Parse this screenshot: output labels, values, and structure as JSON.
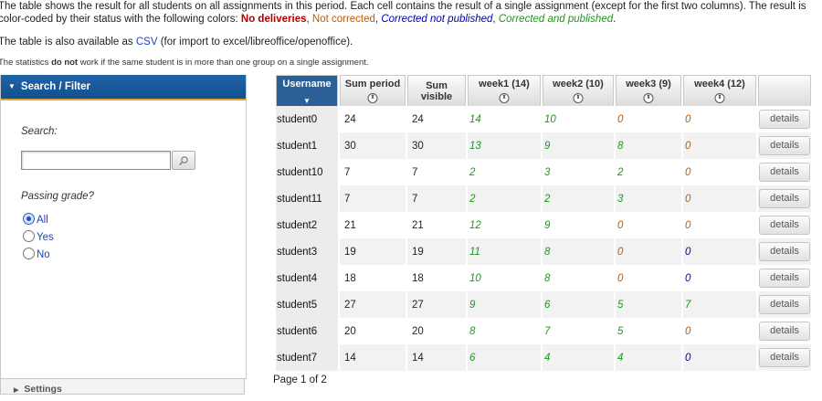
{
  "intro": {
    "p1_start": "The table shows the result for all students on all assignments in this period. Each cell contains the result of a single assignment (except for the first two columns). The result is color-coded by their status with the following colors: ",
    "legend_no_deliveries": "No deliveries",
    "sep1": ", ",
    "legend_not_corrected": "Not corrected",
    "sep2": ", ",
    "legend_not_published": "Corrected not published",
    "sep3": ", ",
    "legend_published": "Corrected and published",
    "p1_end": ".",
    "p2_start": "The table is also available as ",
    "csv_link": "CSV",
    "p2_end": " (for import to excel/libreoffice/openoffice).",
    "p3_start": "The statistics ",
    "p3_bold": "do not",
    "p3_end": " work if the same student is in more than one group on a single assignment."
  },
  "sidebar": {
    "header": "Search / Filter",
    "search_label": "Search:",
    "search_value": "",
    "passing_label": "Passing grade?",
    "options": [
      "All",
      "Yes",
      "No"
    ],
    "selected": "All",
    "settings_label": "Settings"
  },
  "colors": {
    "no_deliveries": "#b00000",
    "not_corrected": "#c05a00",
    "not_published": "#0000c0",
    "published": "#1a9a1a",
    "header_blue": "#2a5f98"
  },
  "table": {
    "headers": {
      "username": "Username",
      "sum_period": "Sum period",
      "sum_visible_1": "Sum",
      "sum_visible_2": "visible",
      "week1": "week1 (14)",
      "week2": "week2 (10)",
      "week3": "week3 (9)",
      "week4": "week4 (12)"
    },
    "details_label": "details",
    "rows": [
      {
        "user": "student0",
        "sum_period": "24",
        "sum_visible": "24",
        "w": [
          {
            "v": "14",
            "s": "pub"
          },
          {
            "v": "10",
            "s": "pub"
          },
          {
            "v": "0",
            "s": "nc"
          },
          {
            "v": "0",
            "s": "nc"
          }
        ]
      },
      {
        "user": "student1",
        "sum_period": "30",
        "sum_visible": "30",
        "w": [
          {
            "v": "13",
            "s": "pub"
          },
          {
            "v": "9",
            "s": "pub"
          },
          {
            "v": "8",
            "s": "pub"
          },
          {
            "v": "0",
            "s": "nc"
          }
        ]
      },
      {
        "user": "student10",
        "sum_period": "7",
        "sum_visible": "7",
        "w": [
          {
            "v": "2",
            "s": "pub"
          },
          {
            "v": "3",
            "s": "pub"
          },
          {
            "v": "2",
            "s": "pub"
          },
          {
            "v": "0",
            "s": "nc"
          }
        ]
      },
      {
        "user": "student11",
        "sum_period": "7",
        "sum_visible": "7",
        "w": [
          {
            "v": "2",
            "s": "pub"
          },
          {
            "v": "2",
            "s": "pub"
          },
          {
            "v": "3",
            "s": "pub"
          },
          {
            "v": "0",
            "s": "nc"
          }
        ]
      },
      {
        "user": "student2",
        "sum_period": "21",
        "sum_visible": "21",
        "w": [
          {
            "v": "12",
            "s": "pub"
          },
          {
            "v": "9",
            "s": "pub"
          },
          {
            "v": "0",
            "s": "nc"
          },
          {
            "v": "0",
            "s": "nc"
          }
        ]
      },
      {
        "user": "student3",
        "sum_period": "19",
        "sum_visible": "19",
        "w": [
          {
            "v": "11",
            "s": "pub"
          },
          {
            "v": "8",
            "s": "pub"
          },
          {
            "v": "0",
            "s": "nc"
          },
          {
            "v": "0",
            "s": "np"
          }
        ]
      },
      {
        "user": "student4",
        "sum_period": "18",
        "sum_visible": "18",
        "w": [
          {
            "v": "10",
            "s": "pub"
          },
          {
            "v": "8",
            "s": "pub"
          },
          {
            "v": "0",
            "s": "nc"
          },
          {
            "v": "0",
            "s": "np"
          }
        ]
      },
      {
        "user": "student5",
        "sum_period": "27",
        "sum_visible": "27",
        "w": [
          {
            "v": "9",
            "s": "pub"
          },
          {
            "v": "6",
            "s": "pub"
          },
          {
            "v": "5",
            "s": "pub"
          },
          {
            "v": "7",
            "s": "pub"
          }
        ]
      },
      {
        "user": "student6",
        "sum_period": "20",
        "sum_visible": "20",
        "w": [
          {
            "v": "8",
            "s": "pub"
          },
          {
            "v": "7",
            "s": "pub"
          },
          {
            "v": "5",
            "s": "pub"
          },
          {
            "v": "0",
            "s": "nc"
          }
        ]
      },
      {
        "user": "student7",
        "sum_period": "14",
        "sum_visible": "14",
        "w": [
          {
            "v": "6",
            "s": "pub"
          },
          {
            "v": "4",
            "s": "pub"
          },
          {
            "v": "4",
            "s": "pub"
          },
          {
            "v": "0",
            "s": "np"
          }
        ]
      }
    ]
  },
  "pager": "Page 1 of 2"
}
